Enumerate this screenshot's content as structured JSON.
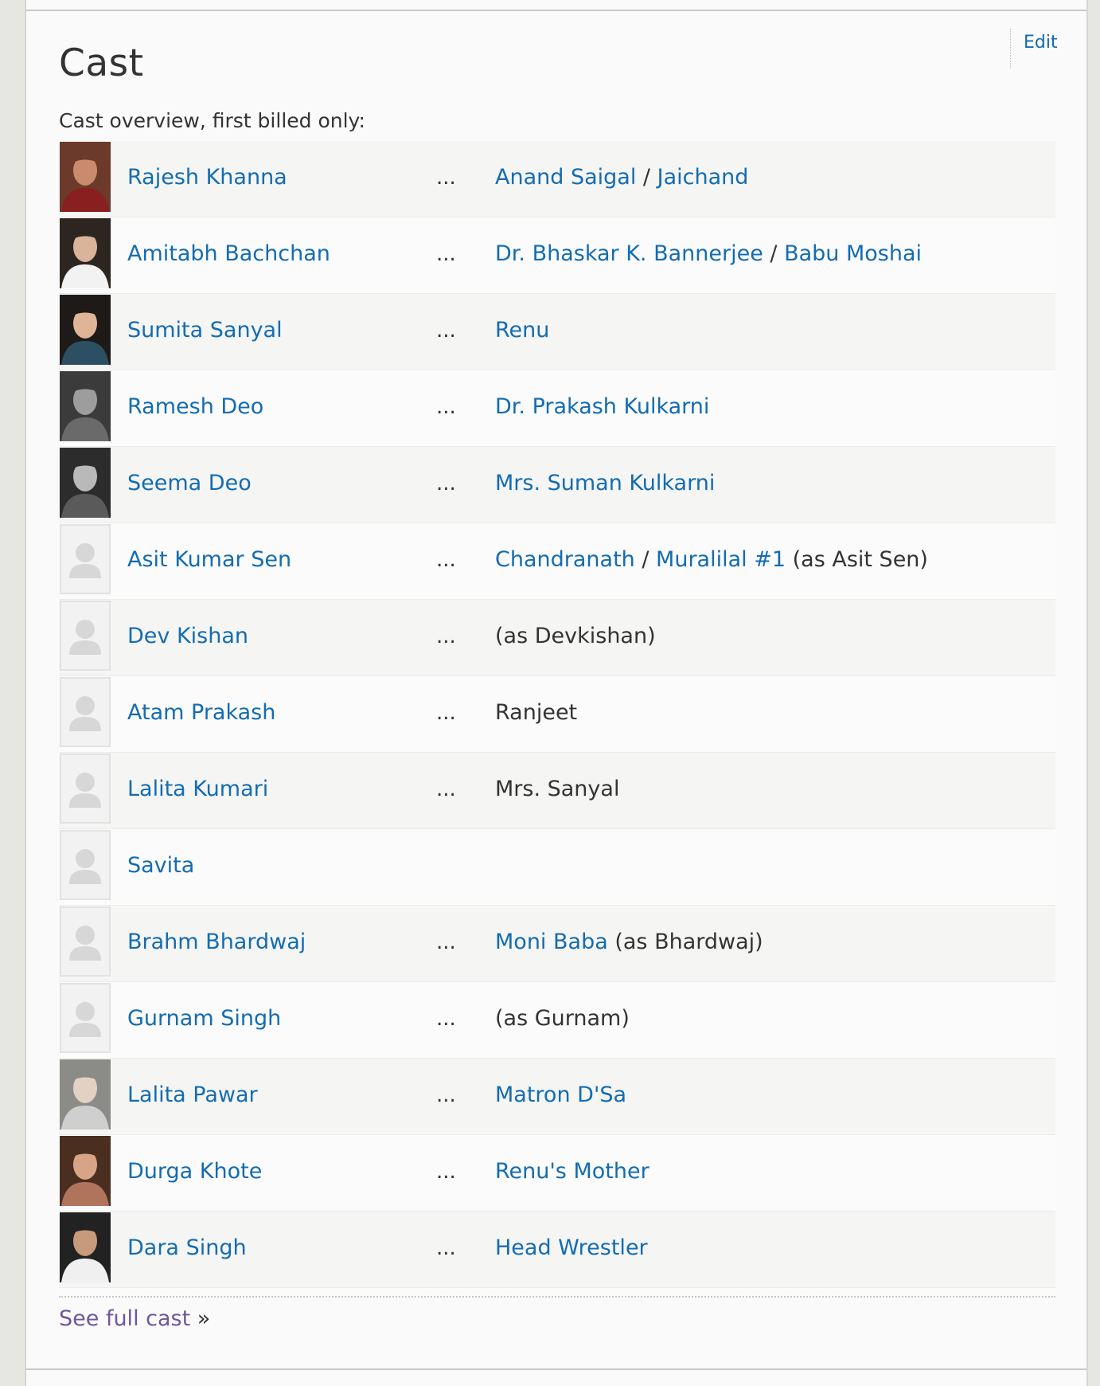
{
  "section": {
    "title": "Cast",
    "edit_label": "Edit",
    "overview_label": "Cast overview, first billed only:",
    "see_full_cast_label": "See full cast",
    "see_full_cast_suffix": "»"
  },
  "colors": {
    "link": "#136cb2",
    "visited_link": "#70579d",
    "text": "#333333",
    "row_alt": "#f5f5f3"
  },
  "cast": [
    {
      "actor": "Rajesh Khanna",
      "photo": "portrait",
      "ellipsis": "...",
      "roles": [
        {
          "text": "Anand Saigal",
          "link": true
        },
        {
          "text": " / ",
          "link": false
        },
        {
          "text": "Jaichand",
          "link": true
        }
      ]
    },
    {
      "actor": "Amitabh Bachchan",
      "photo": "portrait",
      "ellipsis": "...",
      "roles": [
        {
          "text": "Dr. Bhaskar K. Bannerjee",
          "link": true
        },
        {
          "text": " / ",
          "link": false
        },
        {
          "text": "Babu Moshai",
          "link": true
        }
      ]
    },
    {
      "actor": "Sumita Sanyal",
      "photo": "portrait",
      "ellipsis": "...",
      "roles": [
        {
          "text": "Renu",
          "link": true
        }
      ]
    },
    {
      "actor": "Ramesh Deo",
      "photo": "portrait",
      "ellipsis": "...",
      "roles": [
        {
          "text": "Dr. Prakash Kulkarni",
          "link": true
        }
      ]
    },
    {
      "actor": "Seema Deo",
      "photo": "portrait",
      "ellipsis": "...",
      "roles": [
        {
          "text": "Mrs. Suman Kulkarni",
          "link": true
        }
      ]
    },
    {
      "actor": "Asit Kumar Sen",
      "photo": "placeholder",
      "ellipsis": "...",
      "roles": [
        {
          "text": "Chandranath",
          "link": true
        },
        {
          "text": " / ",
          "link": false
        },
        {
          "text": "Muralilal #1",
          "link": true
        },
        {
          "text": " (as Asit Sen)",
          "link": false
        }
      ]
    },
    {
      "actor": "Dev Kishan",
      "photo": "placeholder",
      "ellipsis": "...",
      "roles": [
        {
          "text": "(as Devkishan)",
          "link": false
        }
      ]
    },
    {
      "actor": "Atam Prakash",
      "photo": "placeholder",
      "ellipsis": "...",
      "roles": [
        {
          "text": "Ranjeet",
          "link": false
        }
      ]
    },
    {
      "actor": "Lalita Kumari",
      "photo": "placeholder",
      "ellipsis": "...",
      "roles": [
        {
          "text": "Mrs. Sanyal",
          "link": false
        }
      ]
    },
    {
      "actor": "Savita",
      "photo": "placeholder",
      "ellipsis": "",
      "roles": []
    },
    {
      "actor": "Brahm Bhardwaj",
      "photo": "placeholder",
      "ellipsis": "...",
      "roles": [
        {
          "text": "Moni Baba",
          "link": true
        },
        {
          "text": " (as Bhardwaj)",
          "link": false
        }
      ]
    },
    {
      "actor": "Gurnam Singh",
      "photo": "placeholder",
      "ellipsis": "...",
      "roles": [
        {
          "text": "(as Gurnam)",
          "link": false
        }
      ]
    },
    {
      "actor": "Lalita Pawar",
      "photo": "portrait",
      "ellipsis": "...",
      "roles": [
        {
          "text": "Matron D'Sa",
          "link": true
        }
      ]
    },
    {
      "actor": "Durga Khote",
      "photo": "portrait",
      "ellipsis": "...",
      "roles": [
        {
          "text": "Renu's Mother",
          "link": true
        }
      ]
    },
    {
      "actor": "Dara Singh",
      "photo": "portrait",
      "ellipsis": "...",
      "roles": [
        {
          "text": "Head Wrestler",
          "link": true
        }
      ]
    }
  ]
}
